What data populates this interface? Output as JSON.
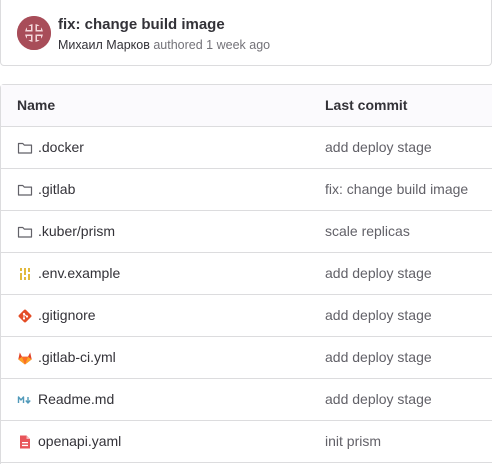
{
  "commit": {
    "title": "fix: change build image",
    "author": "Михаил Марков",
    "meta_text": " authored 1 week ago",
    "avatar_color": "#a84d59"
  },
  "table": {
    "headers": {
      "name": "Name",
      "last_commit": "Last commit"
    },
    "rows": [
      {
        "name": ".docker",
        "commit": "add deploy stage",
        "icon": "folder-icon"
      },
      {
        "name": ".gitlab",
        "commit": "fix: change build image",
        "icon": "folder-icon"
      },
      {
        "name": ".kuber/prism",
        "commit": "scale replicas",
        "icon": "folder-icon"
      },
      {
        "name": ".env.example",
        "commit": "add deploy stage",
        "icon": "env-file-icon"
      },
      {
        "name": ".gitignore",
        "commit": "add deploy stage",
        "icon": "git-icon"
      },
      {
        "name": ".gitlab-ci.yml",
        "commit": "add deploy stage",
        "icon": "gitlab-icon"
      },
      {
        "name": "Readme.md",
        "commit": "add deploy stage",
        "icon": "markdown-icon"
      },
      {
        "name": "openapi.yaml",
        "commit": "init prism",
        "icon": "yaml-file-icon"
      }
    ]
  },
  "colors": {
    "border": "#dcdcde",
    "header_bg": "#fbfafd",
    "text": "#333238",
    "muted": "#626168",
    "git_orange": "#e44d26",
    "env_yellow": "#e2b93d",
    "markdown_blue": "#519aba",
    "yaml_red": "#e8555a"
  }
}
